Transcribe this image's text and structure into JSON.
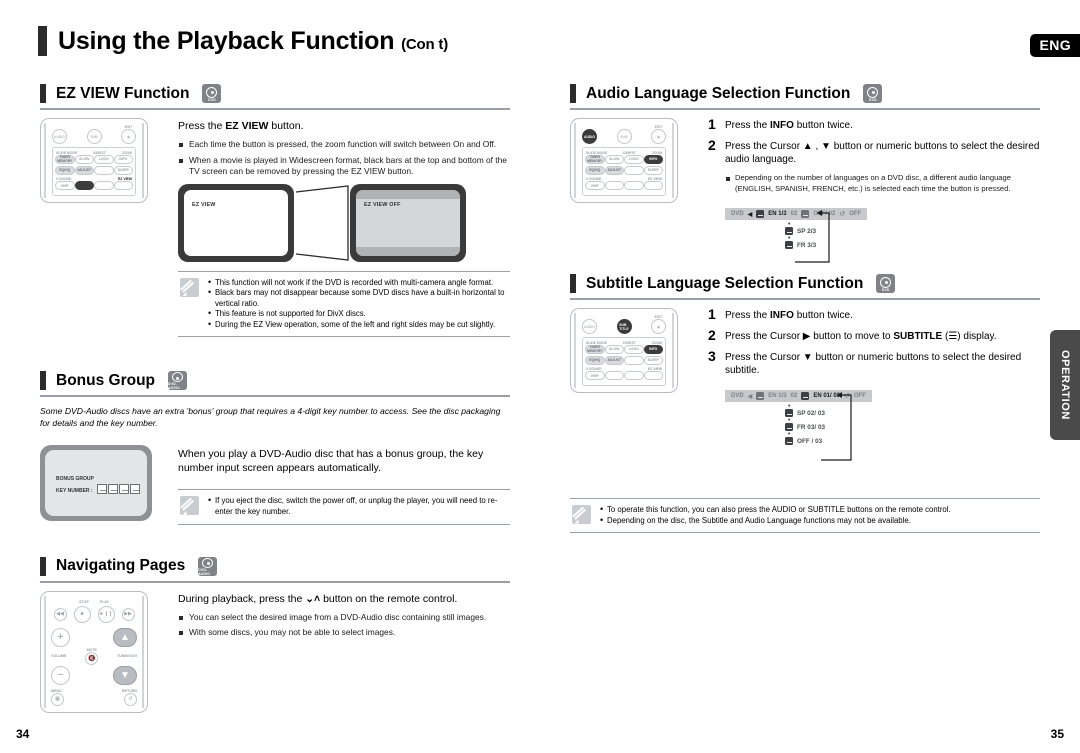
{
  "header": {
    "title": "Using the Playback Function",
    "title_suffix": "(Con t)",
    "lang_tag": "ENG"
  },
  "side_tab": {
    "label": "OPERATION"
  },
  "pages": {
    "left": "34",
    "right": "35"
  },
  "sections": {
    "ez_view": {
      "heading": "EZ VIEW Function",
      "disc_badge": "DVD",
      "lead": "Press the ",
      "lead_bold": "EZ VIEW",
      "lead_tail": " button.",
      "bullets": [
        "Each time the button is pressed, the zoom function will switch between On and Off.",
        "When a movie is played in Widescreen format, black bars at the top and bottom of the TV screen can be removed by pressing the EZ VIEW button."
      ],
      "tv_left_label": "EZ VIEW",
      "tv_right_label": "EZ VIEW OFF",
      "notes": [
        "This function will not work if the DVD is recorded with multi-camera angle format.",
        "Black bars may not disappear because some DVD discs have a built-in horizontal to vertical ratio.",
        "This feature is not supported for DivX discs.",
        "During the EZ View operation, some of the left and right sides may be cut slightly."
      ]
    },
    "bonus_group": {
      "heading": "Bonus Group",
      "disc_badge": "DVD-AUDIO",
      "intro": "Some DVD-Audio discs have an extra 'bonus' group that requires a 4-digit key number to access. See the disc packaging for details and the key number.",
      "body": "When you play a DVD-Audio disc that has a bonus group, the key number input screen appears automatically.",
      "tv_title": "BONUS GROUP",
      "tv_keylabel": "KEY NUMBER :",
      "notes": [
        "If you eject the disc, switch the power off, or unplug the player, you will need to re-enter the key number."
      ]
    },
    "navigating_pages": {
      "heading": "Navigating Pages",
      "disc_badge": "DVD-AUDIO",
      "lead_pre": "During playback, press the ",
      "lead_glyph": "⌄˄",
      "lead_post": " button on the remote control.",
      "bullets": [
        "You can select the desired image from a DVD-Audio disc containing still images.",
        "With some discs, you may not be able to select images."
      ]
    },
    "audio_language": {
      "heading": "Audio Language Selection Function",
      "disc_badge": "DVD",
      "steps": [
        {
          "num": "1",
          "pre": "Press the ",
          "bold": "INFO",
          "post": " button twice."
        },
        {
          "num": "2",
          "pre": "Press the Cursor ▲ , ▼ button or numeric buttons to select the desired audio language.",
          "bold": "",
          "post": ""
        }
      ],
      "bullets": [
        "Depending on the number of languages on a DVD disc, a different audio language (ENGLISH, SPANISH, FRENCH, etc.) is selected each time the button is pressed."
      ],
      "osd": {
        "prefix": "DVD",
        "arrow": "◀",
        "current": "EN 1/3",
        "dim_item": "02",
        "subtitle_item": "OFF/ 02",
        "repeat_item": "OFF",
        "options": [
          "SP 2/3",
          "FR 3/3"
        ]
      }
    },
    "subtitle_language": {
      "heading": "Subtitle Language Selection Function",
      "disc_badge": "DVD",
      "steps": [
        {
          "num": "1",
          "pre": "Press the ",
          "bold": "INFO",
          "post": " button twice."
        },
        {
          "num": "2",
          "pre": "Press the Cursor ▶ button to move to ",
          "bold": "SUBTITLE",
          "post": " (☰) display."
        },
        {
          "num": "3",
          "pre": "Press the Cursor ▼ button or numeric buttons to select the desired subtitle.",
          "bold": "",
          "post": ""
        }
      ],
      "osd": {
        "prefix": "DVD",
        "arrow": "◀",
        "audio_item": "EN 1/3",
        "dim_item": "02",
        "current": "EN 01/ 03",
        "repeat_item": "OFF",
        "options": [
          "SP 02/ 03",
          "FR 03/ 03",
          "OFF / 03"
        ]
      },
      "notes": [
        "To operate this function, you can also press the AUDIO or SUBTITLE buttons on the remote control.",
        "Depending on the disc, the Subtitle and Audio Language functions may not be available."
      ]
    }
  },
  "remote_ez": {
    "top": [
      {
        "label": "AUDIO",
        "style": "plain"
      },
      {
        "label": "SUBTITLE",
        "style": "plain"
      },
      {
        "label": "EXIT",
        "style": "plain"
      }
    ],
    "grid": [
      [
        "SLIDE MODE",
        "DIGEST",
        "ZOOM",
        ""
      ],
      [
        "TIMER MEMORY",
        "SLOW",
        "LOGO",
        "SLEEP"
      ],
      [
        "EQ/HQ",
        "ADJUST",
        "",
        ""
      ],
      [
        "V-SOUND",
        "EZ VIEW",
        "",
        ""
      ],
      [
        "VHIP",
        "",
        "",
        ""
      ]
    ],
    "highlight": "EZ VIEW"
  },
  "remote_audio": {
    "highlight_top": "AUDIO",
    "highlight_grid": "INFO"
  },
  "remote_subtitle": {
    "highlight_top": "SUBTITLE",
    "highlight_grid": "INFO"
  },
  "remote_nav": {
    "top_labels": [
      "STOP",
      "PLAY"
    ],
    "volume_label": "VOLUME",
    "mute_label": "MUTE",
    "tuning_label": "TUNING/CH",
    "menu_label": "MENU",
    "return_label": "RETURN"
  }
}
